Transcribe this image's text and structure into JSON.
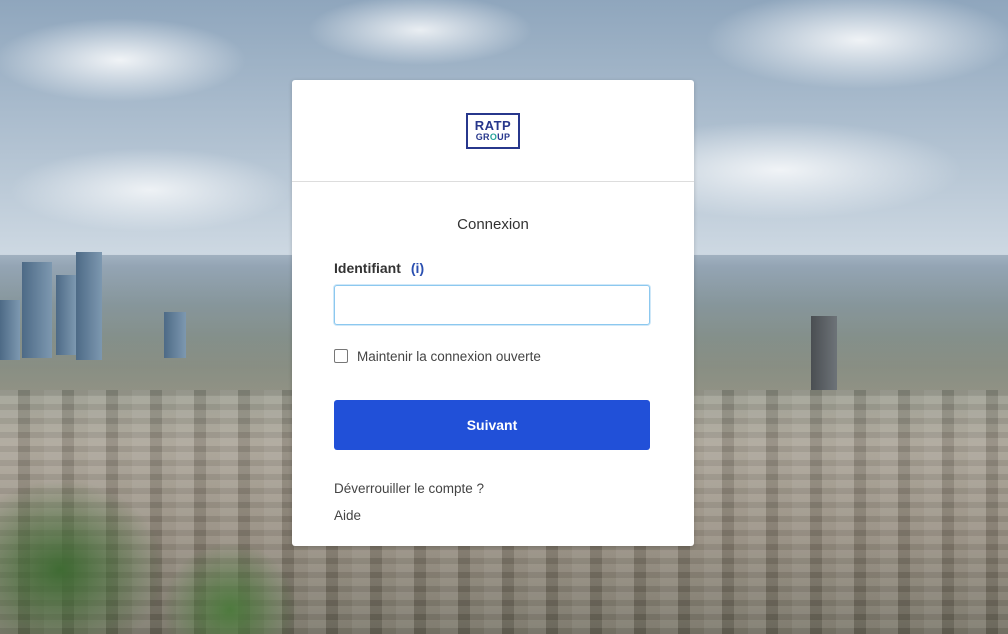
{
  "logo": {
    "line1": "RATP",
    "line2_start": "GR",
    "line2_o": "O",
    "line2_end": "UP"
  },
  "login": {
    "title": "Connexion",
    "username_label": "Identifiant",
    "info_link": "(i)",
    "username_value": "",
    "remember_label": "Maintenir la connexion ouverte",
    "remember_checked": false,
    "submit_label": "Suivant",
    "unlock_link": "Déverrouiller le compte ?",
    "help_link": "Aide"
  },
  "colors": {
    "primary_button": "#2150d8",
    "brand_blue": "#27378c",
    "brand_teal": "#26a69a",
    "link_blue": "#2a4fb0"
  }
}
